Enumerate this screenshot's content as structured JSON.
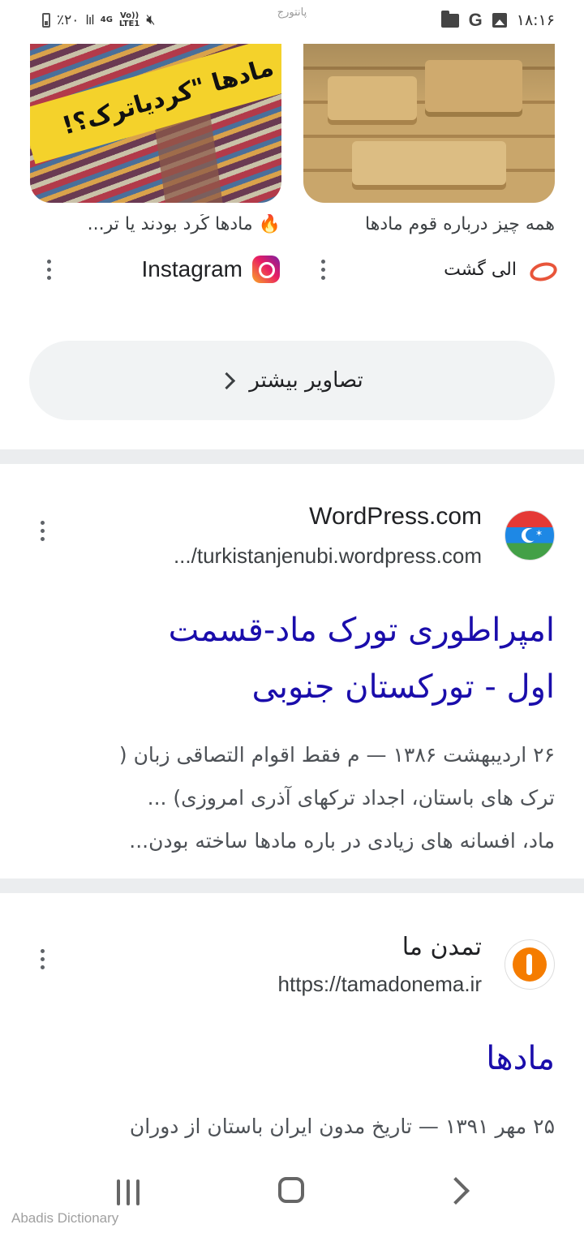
{
  "status_bar": {
    "time": "۱۸:۱۶",
    "battery_percent": "٪۲۰",
    "network_4g": "4G",
    "lte_label": "Vo))\nLTE1",
    "carrier": "پانتورج"
  },
  "image_results": [
    {
      "banner_text": "مادها \"کردیاترک؟!",
      "caption": "🔥 مادها کُرد بودند یا تر...",
      "source": "Instagram"
    },
    {
      "caption": "همه چیز درباره قوم مادها",
      "source": "الی گشت"
    }
  ],
  "more_images_label": "تصاویر بیشتر",
  "results": [
    {
      "site_name": "WordPress.com",
      "url": ".../turkistanjenubi.wordpress.com",
      "title_lines": [
        "امپراطوری تورک ماد-قسمت",
        "اول - تورکستان جنوبی"
      ],
      "snippet_lines": [
        "۲۶ اردیبهشت ۱۳۸۶ — م فقط اقوام التصاقی زبان (",
        "ترک های باستان، اجداد ترکهای آذری امروزی) ...",
        "ماد، افسانه های زیادی در باره مادها ساخته بودن..."
      ]
    },
    {
      "site_name": "تمدن ما",
      "url": "https://tamadonema.ir",
      "title_lines": [
        "مادها"
      ],
      "snippet_lines": [
        "۲۵ مهر ۱۳۹۱ — تاریخ مدون ایران باستان از دوران"
      ]
    }
  ],
  "watermark": "Abadis Dictionary"
}
